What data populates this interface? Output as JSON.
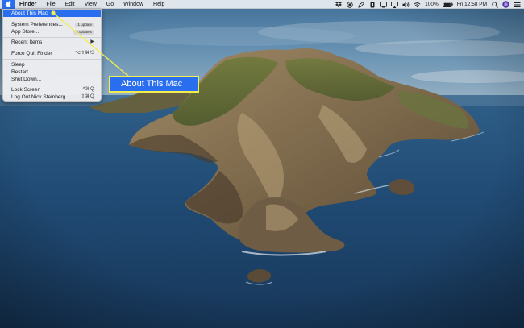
{
  "menubar": {
    "items": [
      "Finder",
      "File",
      "Edit",
      "View",
      "Go",
      "Window",
      "Help"
    ],
    "battery": "100%",
    "clock": "Fri 12:58 PM"
  },
  "apple_menu": {
    "about": "About This Mac",
    "system_preferences": "System Preferences...",
    "system_preferences_badge": "1 update",
    "app_store": "App Store...",
    "app_store_badge": "4 updates",
    "recent_items": "Recent Items",
    "force_quit": "Force Quit Finder",
    "force_quit_shortcut": "⌥⇧⌘⎋",
    "sleep": "Sleep",
    "restart": "Restart...",
    "shut_down": "Shut Down...",
    "lock_screen": "Lock Screen",
    "lock_screen_shortcut": "^⌘Q",
    "log_out": "Log Out Nick Steinberg...",
    "log_out_shortcut": "⇧⌘Q"
  },
  "callout": {
    "label": "About This Mac"
  },
  "colors": {
    "highlight": "#2a6ef0",
    "callout_border": "#f2ee4f",
    "sea": "#1e4266",
    "sky": "#5d87a9"
  },
  "icons": [
    "apple-icon",
    "dropbox-icon",
    "record-icon",
    "pen-icon",
    "battery-status-icon",
    "display-icon",
    "airplay-icon",
    "volume-icon",
    "wifi-icon",
    "battery-icon",
    "search-icon",
    "siri-icon",
    "control-center-icon"
  ]
}
